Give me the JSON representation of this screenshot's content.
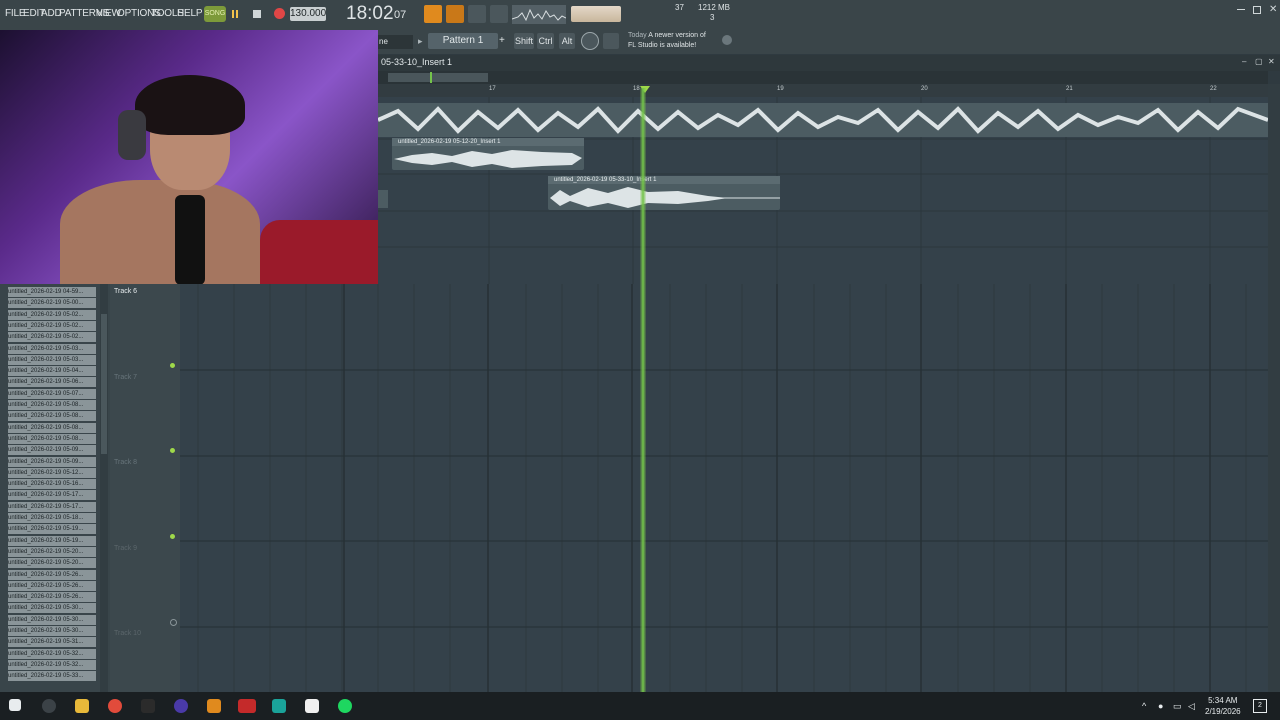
{
  "menu": [
    "FILE",
    "EDIT",
    "ADD",
    "PATTERNS",
    "VIEW",
    "OPTIONS",
    "TOOLS",
    "HELP"
  ],
  "transport": {
    "song_label": "SONG",
    "tempo": "130.000",
    "time": "18:02",
    "time_small": "07"
  },
  "cpu": {
    "value": "37",
    "memory": "1212 MB",
    "voices": "3"
  },
  "subbar": {
    "mode": "ne",
    "pattern": "Pattern 1",
    "shift": "Shift",
    "ctrl": "Ctrl",
    "alt": "Alt",
    "news_day": "Today",
    "news_line1": "A newer version of",
    "news_line2": "FL Studio is available!"
  },
  "playlist": {
    "title": "05-33-10_Insert 1",
    "ruler": [
      "17",
      "18",
      "19",
      "20",
      "21",
      "22"
    ],
    "clips": [
      {
        "label": "untitled_2026-02-19 05-12-20_Insert 1"
      },
      {
        "label": "untitled_2026-02-19 05-33-10_Insert 1"
      }
    ],
    "tracks": [
      "Track 6",
      "Track 7",
      "Track 8",
      "Track 9",
      "Track 10"
    ]
  },
  "browser": {
    "items": [
      "untitled_2026-02-19 04-59...",
      "untitled_2026-02-19 05-00...",
      "untitled_2026-02-19 05-02...",
      "untitled_2026-02-19 05-02...",
      "untitled_2026-02-19 05-02...",
      "untitled_2026-02-19 05-03...",
      "untitled_2026-02-19 05-03...",
      "untitled_2026-02-19 05-04...",
      "untitled_2026-02-19 05-06...",
      "untitled_2026-02-19 05-07...",
      "untitled_2026-02-19 05-08...",
      "untitled_2026-02-19 05-08...",
      "untitled_2026-02-19 05-08...",
      "untitled_2026-02-19 05-08...",
      "untitled_2026-02-19 05-09...",
      "untitled_2026-02-19 05-09...",
      "untitled_2026-02-19 05-12...",
      "untitled_2026-02-19 05-16...",
      "untitled_2026-02-19 05-17...",
      "untitled_2026-02-19 05-17...",
      "untitled_2026-02-19 05-18...",
      "untitled_2026-02-19 05-19...",
      "untitled_2026-02-19 05-19...",
      "untitled_2026-02-19 05-20...",
      "untitled_2026-02-19 05-20...",
      "untitled_2026-02-19 05-26...",
      "untitled_2026-02-19 05-26...",
      "untitled_2026-02-19 05-26...",
      "untitled_2026-02-19 05-30...",
      "untitled_2026-02-19 05-30...",
      "untitled_2026-02-19 05-30...",
      "untitled_2026-02-19 05-31...",
      "untitled_2026-02-19 05-32...",
      "untitled_2026-02-19 05-32...",
      "untitled_2026-02-19 05-33..."
    ]
  },
  "taskbar": {
    "time": "5:34 AM",
    "date": "2/19/2026",
    "notif_count": "2"
  },
  "colors": {
    "playhead": "#74c44a",
    "accent_orange": "#e08a1e",
    "record": "#e04646"
  }
}
